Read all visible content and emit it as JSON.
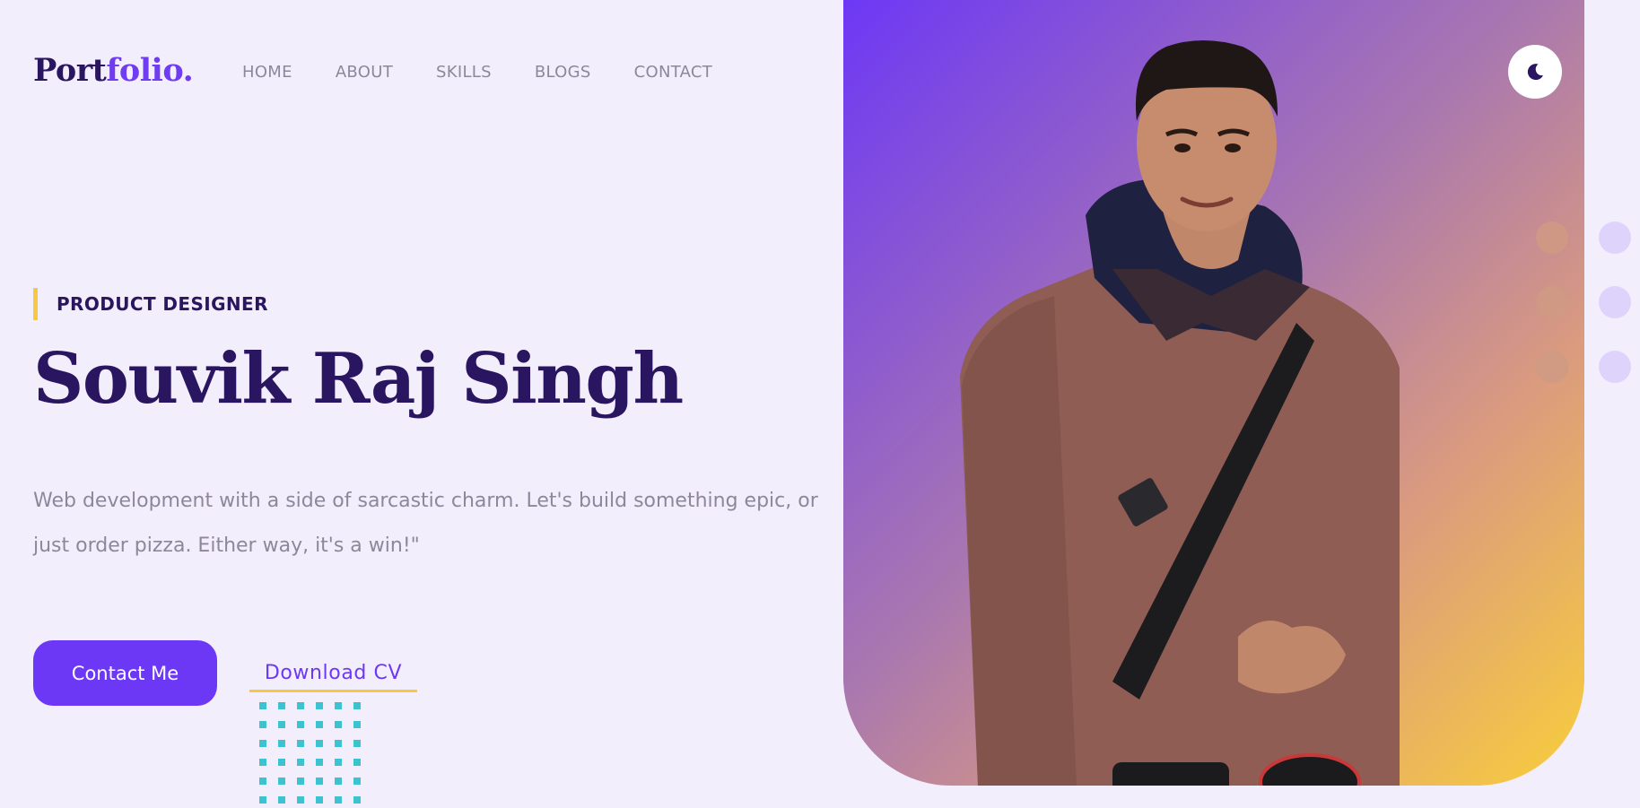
{
  "logo": {
    "part1": "Port",
    "part2": "folio",
    "part3": "."
  },
  "nav": {
    "items": [
      "HOME",
      "ABOUT",
      "SKILLS",
      "BLOGS",
      "CONTACT"
    ]
  },
  "hero": {
    "role": "PRODUCT DESIGNER",
    "name": "Souvik Raj Singh",
    "description": "Web development with a side of sarcastic charm. Let's build something epic, or just order pizza. Either way, it's a win!\"",
    "contact_label": "Contact Me",
    "cv_label": "Download CV"
  },
  "theme_toggle": {
    "icon": "moon-icon"
  },
  "colors": {
    "background": "#f3eefc",
    "primary": "#6d38f5",
    "heading": "#2a1560",
    "accent_yellow": "#f7c843",
    "dots_teal": "#3cc3d0",
    "muted_text": "#8d879c"
  }
}
